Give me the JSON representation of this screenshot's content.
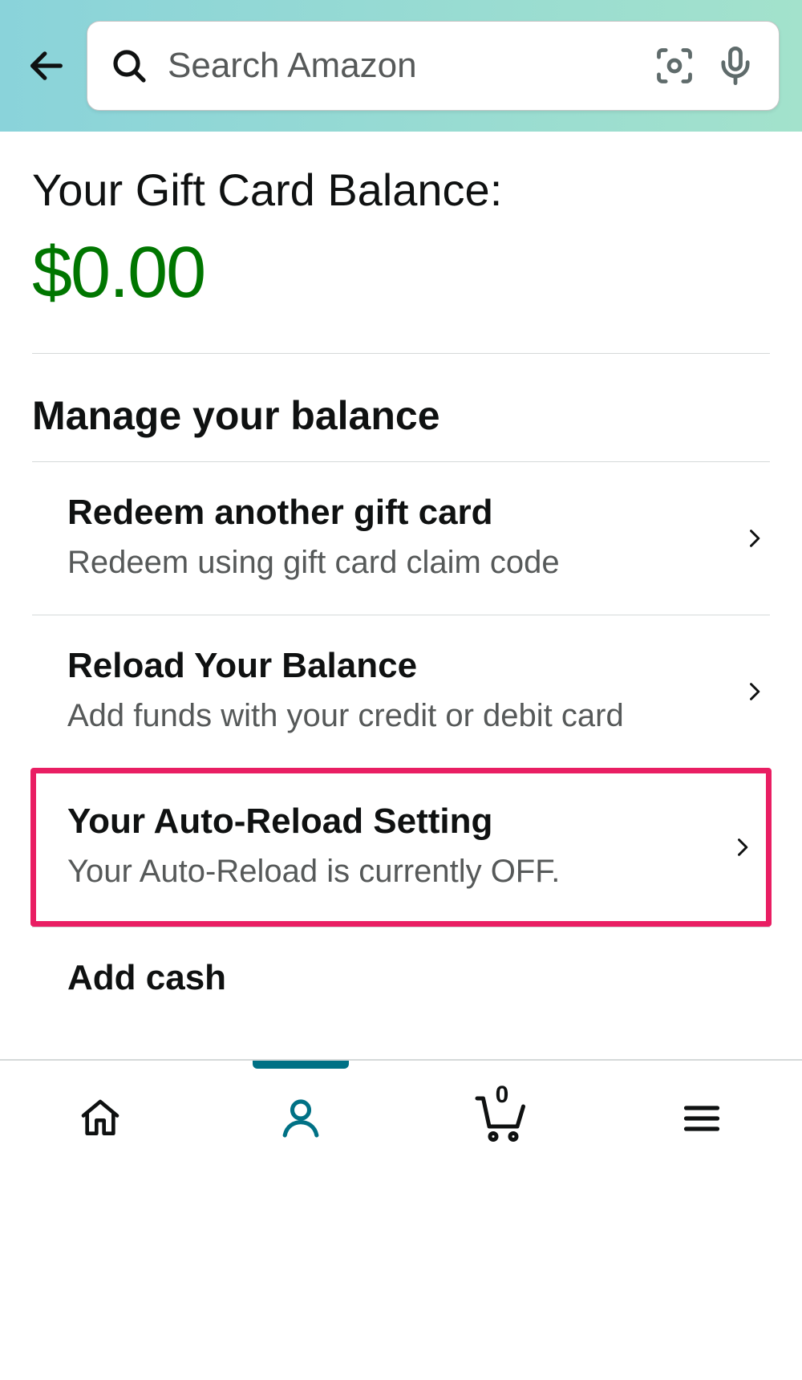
{
  "header": {
    "search_placeholder": "Search Amazon"
  },
  "balance": {
    "title": "Your Gift Card Balance:",
    "amount": "$0.00"
  },
  "manage": {
    "section_title": "Manage your balance",
    "items": [
      {
        "title": "Redeem another gift card",
        "subtitle": "Redeem using gift card claim code"
      },
      {
        "title": "Reload Your Balance",
        "subtitle": "Add funds with your credit or debit card"
      },
      {
        "title": "Your Auto-Reload Setting",
        "subtitle": "Your Auto-Reload is currently OFF."
      },
      {
        "title": "Add cash"
      }
    ]
  },
  "nav": {
    "cart_count": "0"
  }
}
